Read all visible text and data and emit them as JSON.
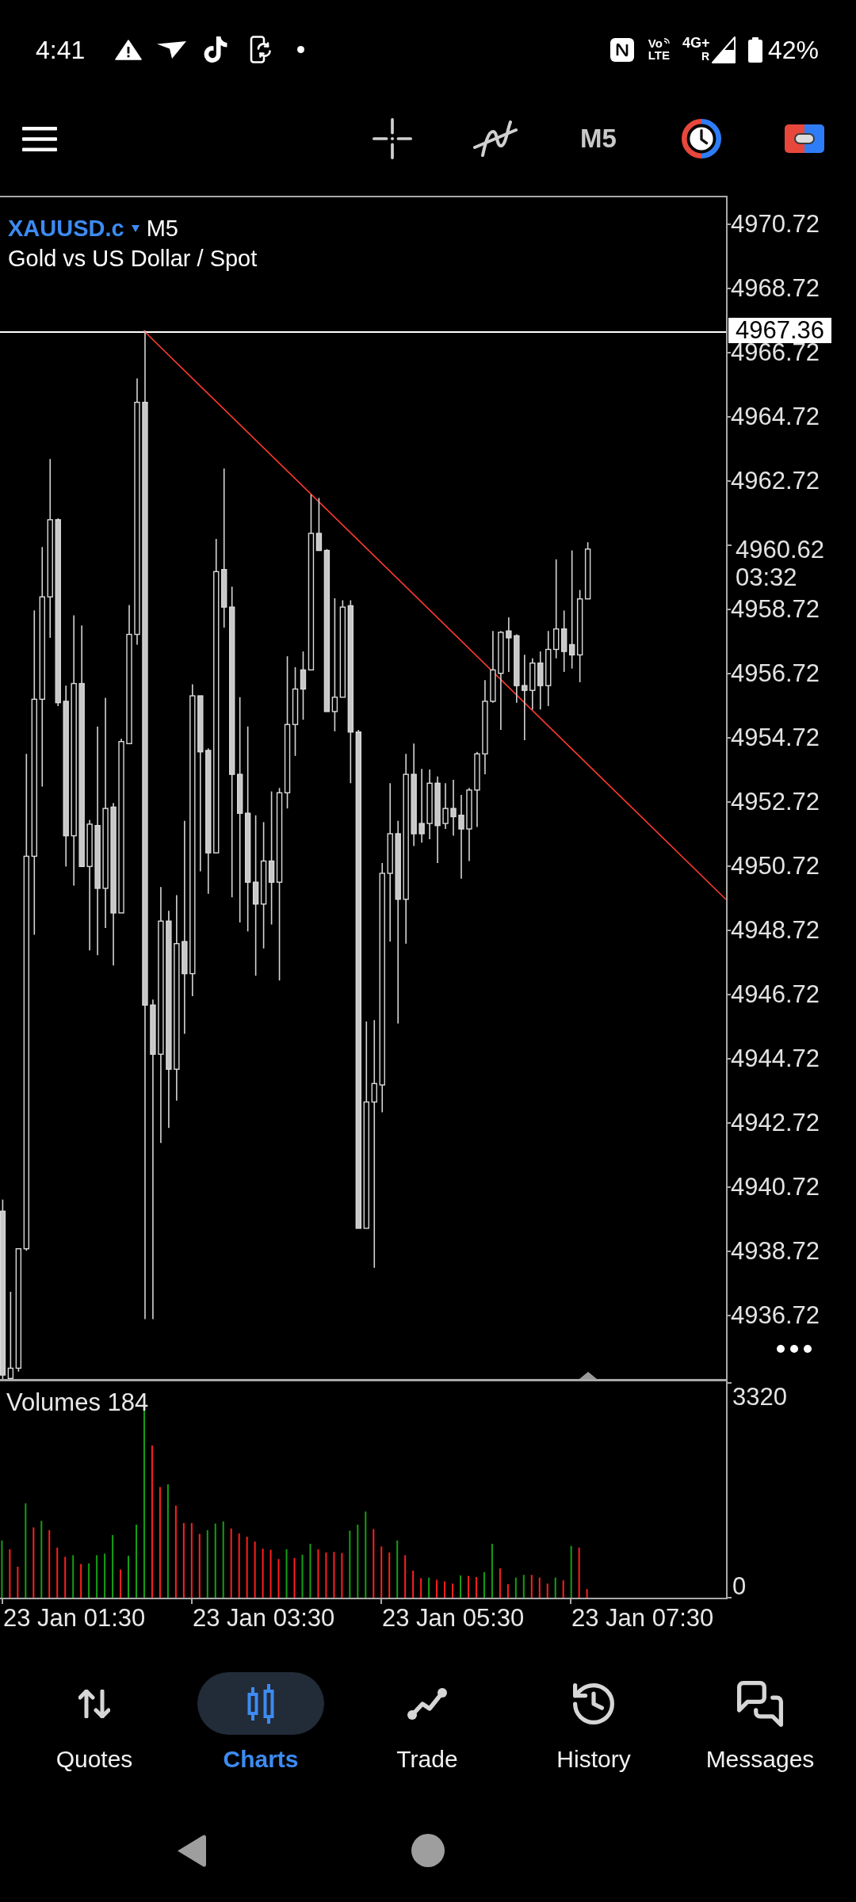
{
  "status_bar": {
    "time": "4:41",
    "volte_top": "Vo",
    "volte_bottom": "LTE",
    "network": "4G+",
    "roaming": "R",
    "battery": "42%"
  },
  "toolbar": {
    "timeframe": "M5"
  },
  "chart": {
    "symbol": "XAUUSD.c",
    "timeframe": "M5",
    "description": "Gold vs US Dollar / Spot",
    "price_axis": [
      "4970.72",
      "4968.72",
      "4966.72",
      "4964.72",
      "4962.72",
      "4958.72",
      "4956.72",
      "4954.72",
      "4952.72",
      "4950.72",
      "4948.72",
      "4946.72",
      "4944.72",
      "4942.72",
      "4940.72",
      "4938.72",
      "4936.72"
    ],
    "level_line_price": "4967.36",
    "current_price": "4960.62",
    "bar_countdown": "03:32"
  },
  "volume_panel": {
    "title": "Volumes 184",
    "axis_max": "3320",
    "axis_min": "0"
  },
  "time_axis": [
    "23 Jan 01:30",
    "23 Jan 03:30",
    "23 Jan 05:30",
    "23 Jan 07:30"
  ],
  "bottom_nav": [
    {
      "label": "Quotes",
      "selected": false
    },
    {
      "label": "Charts",
      "selected": true
    },
    {
      "label": "Trade",
      "selected": false
    },
    {
      "label": "History",
      "selected": false
    },
    {
      "label": "Messages",
      "selected": false
    }
  ]
}
